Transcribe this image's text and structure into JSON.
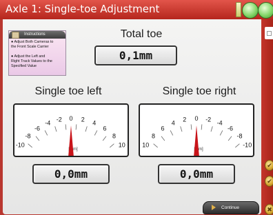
{
  "window": {
    "title": "Axle 1: Single-toe Adjustment"
  },
  "instructions": {
    "header": "Instructions",
    "lines": [
      "● Adjust Both Cameras to",
      "the Front Scale Carrier",
      "",
      "● Adjust the Left and",
      "Right Track Values to the",
      "Specified Value"
    ]
  },
  "total_toe": {
    "label": "Total toe",
    "value": "0,1mm"
  },
  "left": {
    "label": "Single toe left",
    "value": "0,0mm",
    "unit": "[mm]",
    "ticks": [
      "-10",
      "-8",
      "-6",
      "-4",
      "-2",
      "0",
      "2",
      "4",
      "6",
      "8",
      "10"
    ],
    "needle": 0
  },
  "right": {
    "label": "Single toe right",
    "value": "0,0mm",
    "unit": "[mm]",
    "ticks": [
      "10",
      "8",
      "6",
      "4",
      "2",
      "0",
      "-2",
      "-4",
      "-6",
      "-8",
      "-10"
    ],
    "needle": 0
  },
  "actions": {
    "continue": "Continue"
  },
  "colors": {
    "frame": "#b9372f",
    "needle": "#c8141a",
    "lamp": "#6cc24f"
  },
  "icons": {
    "status": "green-lamp-icon",
    "side": [
      "check-icon",
      "check-icon",
      "close-icon"
    ]
  }
}
